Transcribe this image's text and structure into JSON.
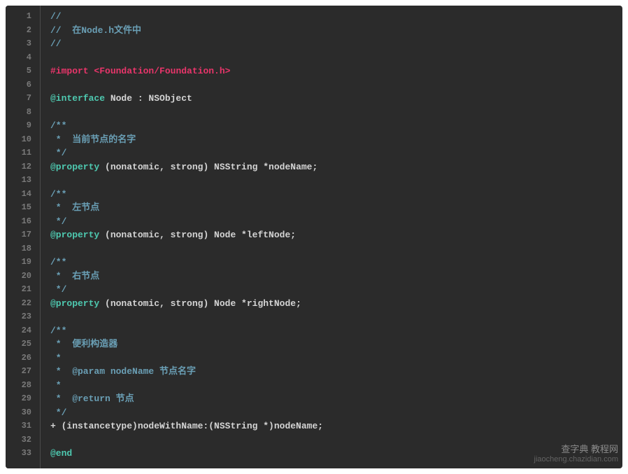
{
  "watermark": {
    "line1": "查字典  教程网",
    "line2": "jiaocheng.chazidian.com"
  },
  "lines": [
    {
      "num": 1,
      "tokens": [
        {
          "cls": "comment",
          "t": "//"
        }
      ]
    },
    {
      "num": 2,
      "tokens": [
        {
          "cls": "comment",
          "t": "//  在Node.h文件中"
        }
      ]
    },
    {
      "num": 3,
      "tokens": [
        {
          "cls": "comment",
          "t": "//"
        }
      ]
    },
    {
      "num": 4,
      "tokens": []
    },
    {
      "num": 5,
      "tokens": [
        {
          "cls": "import-kw",
          "t": "#import "
        },
        {
          "cls": "import-path",
          "t": "<Foundation/Foundation.h>"
        }
      ]
    },
    {
      "num": 6,
      "tokens": []
    },
    {
      "num": 7,
      "tokens": [
        {
          "cls": "keyword",
          "t": "@interface"
        },
        {
          "cls": "white",
          "t": " Node : NSObject"
        }
      ]
    },
    {
      "num": 8,
      "tokens": []
    },
    {
      "num": 9,
      "tokens": [
        {
          "cls": "comment",
          "t": "/**"
        }
      ]
    },
    {
      "num": 10,
      "tokens": [
        {
          "cls": "comment",
          "t": " *  当前节点的名字"
        }
      ]
    },
    {
      "num": 11,
      "tokens": [
        {
          "cls": "comment",
          "t": " */"
        }
      ]
    },
    {
      "num": 12,
      "tokens": [
        {
          "cls": "keyword",
          "t": "@property"
        },
        {
          "cls": "white",
          "t": " (nonatomic, strong) NSString *nodeName;"
        }
      ]
    },
    {
      "num": 13,
      "tokens": []
    },
    {
      "num": 14,
      "tokens": [
        {
          "cls": "comment",
          "t": "/**"
        }
      ]
    },
    {
      "num": 15,
      "tokens": [
        {
          "cls": "comment",
          "t": " *  左节点"
        }
      ]
    },
    {
      "num": 16,
      "tokens": [
        {
          "cls": "comment",
          "t": " */"
        }
      ]
    },
    {
      "num": 17,
      "tokens": [
        {
          "cls": "keyword",
          "t": "@property"
        },
        {
          "cls": "white",
          "t": " (nonatomic, strong) Node *leftNode;"
        }
      ]
    },
    {
      "num": 18,
      "tokens": []
    },
    {
      "num": 19,
      "tokens": [
        {
          "cls": "comment",
          "t": "/**"
        }
      ]
    },
    {
      "num": 20,
      "tokens": [
        {
          "cls": "comment",
          "t": " *  右节点"
        }
      ]
    },
    {
      "num": 21,
      "tokens": [
        {
          "cls": "comment",
          "t": " */"
        }
      ]
    },
    {
      "num": 22,
      "tokens": [
        {
          "cls": "keyword",
          "t": "@property"
        },
        {
          "cls": "white",
          "t": " (nonatomic, strong) Node *rightNode;"
        }
      ]
    },
    {
      "num": 23,
      "tokens": []
    },
    {
      "num": 24,
      "tokens": [
        {
          "cls": "comment",
          "t": "/**"
        }
      ]
    },
    {
      "num": 25,
      "tokens": [
        {
          "cls": "comment",
          "t": " *  便利构造器"
        }
      ]
    },
    {
      "num": 26,
      "tokens": [
        {
          "cls": "comment",
          "t": " *"
        }
      ]
    },
    {
      "num": 27,
      "tokens": [
        {
          "cls": "comment",
          "t": " *  @param nodeName 节点名字"
        }
      ]
    },
    {
      "num": 28,
      "tokens": [
        {
          "cls": "comment",
          "t": " *"
        }
      ]
    },
    {
      "num": 29,
      "tokens": [
        {
          "cls": "comment",
          "t": " *  @return 节点"
        }
      ]
    },
    {
      "num": 30,
      "tokens": [
        {
          "cls": "comment",
          "t": " */"
        }
      ]
    },
    {
      "num": 31,
      "tokens": [
        {
          "cls": "white",
          "t": "+ (instancetype)nodeWithName:(NSString *)nodeName;"
        }
      ]
    },
    {
      "num": 32,
      "tokens": []
    },
    {
      "num": 33,
      "tokens": [
        {
          "cls": "keyword",
          "t": "@end"
        }
      ]
    }
  ]
}
